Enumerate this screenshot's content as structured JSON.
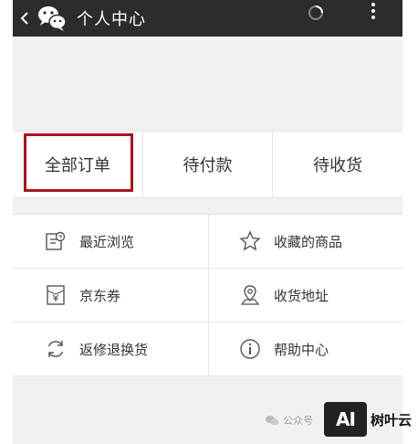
{
  "header": {
    "title": "个人中心",
    "bg_color": "#2c2c2c",
    "icons": [
      "chevron-left-icon",
      "wechat-logo-icon",
      "loading-spinner-icon",
      "more-vertical-icon"
    ]
  },
  "order_tabs": [
    {
      "label": "全部订单",
      "selected": true
    },
    {
      "label": "待付款",
      "selected": false
    },
    {
      "label": "待收货",
      "selected": false
    }
  ],
  "highlight_color": "#a4161c",
  "menu": [
    {
      "label": "最近浏览",
      "icon": "calendar-icon"
    },
    {
      "label": "收藏的商品",
      "icon": "star-icon"
    },
    {
      "label": "京东券",
      "icon": "coupon-icon"
    },
    {
      "label": "收货地址",
      "icon": "location-pin-icon"
    },
    {
      "label": "返修退换货",
      "icon": "refresh-icon"
    },
    {
      "label": "帮助中心",
      "icon": "info-icon"
    }
  ],
  "watermark": {
    "left_text": "公众号",
    "badge_text": "AI",
    "brand_text": "树叶云"
  }
}
